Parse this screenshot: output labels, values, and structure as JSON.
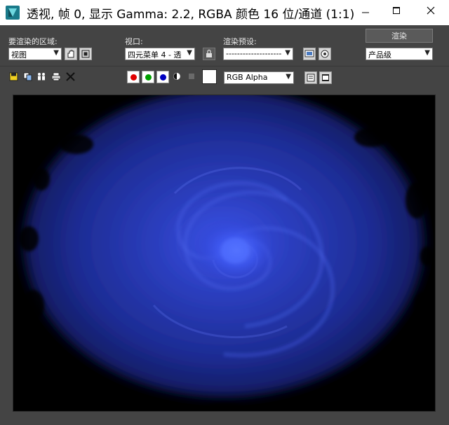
{
  "window": {
    "title": "透视, 帧 0, 显示 Gamma: 2.2, RGBA 颜色 16 位/通道 (1:1)",
    "app_icon": "3ds-max-logo-icon",
    "controls": [
      "minimize-icon",
      "maximize-icon",
      "close-icon"
    ]
  },
  "panel": {
    "area_label": "要渲染的区域:",
    "area_value": "视图",
    "viewport_label": "视口:",
    "viewport_value": "四元菜单 4 - 透",
    "preset_label": "渲染预设:",
    "preset_value": "--------------------",
    "render_button": "渲染",
    "quality_value": "产品级",
    "channel_display_value": "RGB Alpha"
  },
  "toolbar": {
    "tools": [
      "save-image-icon",
      "copy-image-icon",
      "clone-window-icon",
      "print-icon",
      "clear-icon"
    ],
    "channels": [
      {
        "name": "red",
        "color": "#e00000"
      },
      {
        "name": "green",
        "color": "#00a000"
      },
      {
        "name": "blue",
        "color": "#0000c0"
      }
    ]
  },
  "colors": {
    "background": "#444444",
    "titlebar": "#ffffff",
    "render_deep_blue": "#1a2aa0",
    "render_glow": "#4a66ff"
  }
}
